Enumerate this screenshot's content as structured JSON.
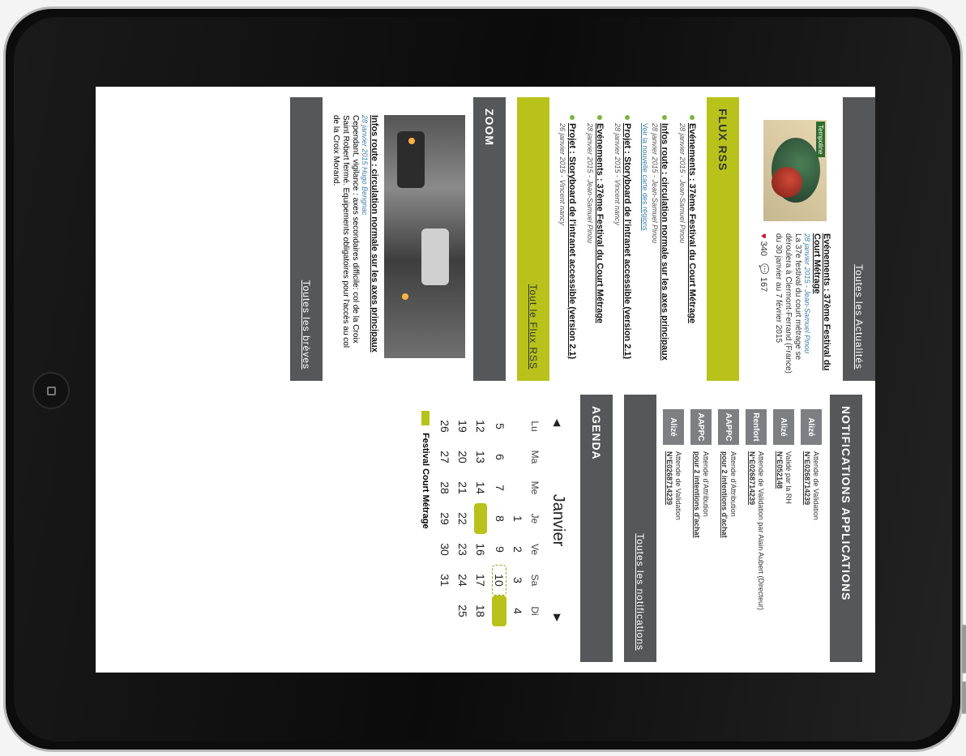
{
  "news": {
    "header_link": "Toutes les Actualités",
    "thumb_tag": "Tempoline",
    "title": "Evénements : 37ème Festival du Court Métrage",
    "meta": "28 janvier 2015 - Jean-Samuel Pinou",
    "summary": "La 37e festival du court métrage se déroulera à Clermont-Ferrand (France) du 30 janvier au 7 février 2015",
    "likes": "340",
    "comments": "167"
  },
  "rss": {
    "title": "FLUX RSS",
    "all_link": "Tout le Flux RSS",
    "items": [
      {
        "title": "Evénements : 37ème Festival du Court Métrage",
        "meta": "28 janvier 2015 - Jean-Samuel Pinou",
        "link": ""
      },
      {
        "title": "Infos route : circulation normale sur les axes principaux",
        "meta": "28 janvier 2015 - Jean-Samuel Pinou",
        "link": "Voir la nouvelle carte des régions"
      },
      {
        "title": "Projet : Storyboard de l'intranet accessible (version 2.1)",
        "meta": "28 janvier 2015 - Vincent nancy",
        "link": ""
      },
      {
        "title": "Evénements : 37ème Festival du Court Métrage",
        "meta": "28 janvier 2015 - Jean-Samuel Pinou",
        "link": ""
      },
      {
        "title": "Projet : Storyboard de l'intranet accessible (version 2.1)",
        "meta": "26 janvier 2015 - Vincent nancy",
        "link": ""
      }
    ]
  },
  "zoom": {
    "title": "ZOOM",
    "headline": "Infos route : circulation normale sur les axes principaux",
    "meta": "28 janvier 2015 Hugo Bengnac",
    "text": "Cependant, vigilance : axes secondaires difficile: col de la Croix Saint Robert fermé. Equipements obligatoires pour l'accès au col de la Croix Morand.",
    "all_link": "Toutes les brèves"
  },
  "notifications": {
    "title": "NOTIFICATIONS APPLICATIONS",
    "all_link": "Toutes les notifications",
    "items": [
      {
        "badge": "Alizé",
        "status": "Attende de Validation",
        "ref": "N°E0268714239"
      },
      {
        "badge": "Alizé",
        "status": "Validé par la RH",
        "ref": "N°E052148"
      },
      {
        "badge": "Renfort",
        "status": "Attende de Validation par Alain Aubert (Directeur)",
        "ref": "N°E0268714239"
      },
      {
        "badge": "AAPPC",
        "status": "Attende d'Attribution",
        "ref": "pour 2 intentions d'achat"
      },
      {
        "badge": "AAPPC",
        "status": "Attende d'Attribution",
        "ref": "pour 2 intentions d'achat"
      },
      {
        "badge": "Alizé",
        "status": "Attende de Validation",
        "ref": "N°E0268714239"
      }
    ]
  },
  "agenda": {
    "title": "AGENDA",
    "month": "Janvier",
    "prev": "◀",
    "next": "▶",
    "days": [
      "Lu",
      "Ma",
      "Me",
      "Je",
      "Ve",
      "Sa",
      "Di"
    ],
    "weeks": [
      [
        "",
        "",
        "",
        "1",
        "2",
        "3",
        "4"
      ],
      [
        "5",
        "6",
        "7",
        "8",
        "9",
        "10",
        "11"
      ],
      [
        "12",
        "13",
        "14",
        "15",
        "16",
        "17",
        "18"
      ],
      [
        "19",
        "20",
        "21",
        "22",
        "23",
        "24",
        "25"
      ],
      [
        "26",
        "27",
        "28",
        "29",
        "30",
        "31",
        ""
      ]
    ],
    "event_days": [
      "11",
      "15"
    ],
    "today": "10",
    "event_label": "Festival Court Métrage"
  },
  "colors": {
    "accent": "#b9c21a",
    "bar": "#55575b",
    "link": "#3d7fae",
    "heart": "#c8102e"
  }
}
